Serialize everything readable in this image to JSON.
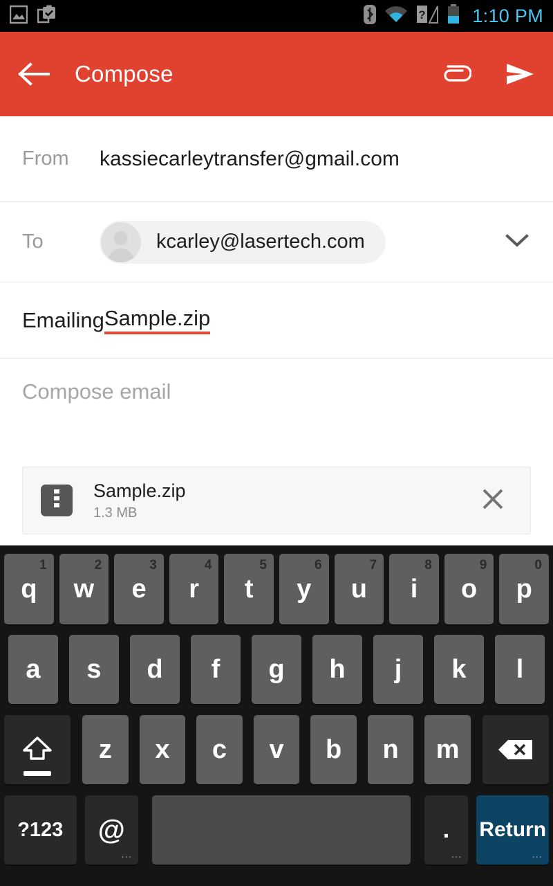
{
  "status_bar": {
    "left_icons": [
      {
        "name": "image-icon",
        "glyph": "image"
      },
      {
        "name": "clipboard-check-icon",
        "glyph": "clipboard"
      }
    ],
    "right_icons": [
      {
        "name": "bluetooth-icon"
      },
      {
        "name": "wifi-icon"
      },
      {
        "name": "cellular-unknown-sim-icon"
      },
      {
        "name": "battery-icon"
      }
    ],
    "time": "1:10 PM",
    "time_color": "#46c8f0",
    "background_color": "#000000"
  },
  "app_bar": {
    "back_label": "Back",
    "title": "Compose",
    "attach_label": "Attach file",
    "send_label": "Send",
    "background_color": "#e0422f",
    "text_color": "#ffffff"
  },
  "compose": {
    "from": {
      "label": "From",
      "value": "kassiecarleytransfer@gmail.com"
    },
    "to": {
      "label": "To",
      "recipient": "kcarley@lasertech.com",
      "expand_label": "Show Cc/Bcc"
    },
    "subject": {
      "prefix": "Emailing ",
      "misspelled": "Sample.zip",
      "full_value": "Emailing Sample.zip",
      "underline_color": "#ef4631"
    },
    "body": {
      "placeholder": "Compose email",
      "value": ""
    },
    "attachment": {
      "icon": "zip-file-icon",
      "name": "Sample.zip",
      "size": "1.3 MB",
      "remove_label": "Remove attachment"
    }
  },
  "keyboard": {
    "background_color": "#151515",
    "key_color": "#5f5f5f",
    "modifier_key_color": "#292929",
    "return_key_color": "#0d4463",
    "row1": [
      {
        "label": "q",
        "sup": "1"
      },
      {
        "label": "w",
        "sup": "2"
      },
      {
        "label": "e",
        "sup": "3"
      },
      {
        "label": "r",
        "sup": "4"
      },
      {
        "label": "t",
        "sup": "5"
      },
      {
        "label": "y",
        "sup": "6"
      },
      {
        "label": "u",
        "sup": "7"
      },
      {
        "label": "i",
        "sup": "8"
      },
      {
        "label": "o",
        "sup": "9"
      },
      {
        "label": "p",
        "sup": "0"
      }
    ],
    "row2": [
      {
        "label": "a"
      },
      {
        "label": "s"
      },
      {
        "label": "d"
      },
      {
        "label": "f"
      },
      {
        "label": "g"
      },
      {
        "label": "h"
      },
      {
        "label": "j"
      },
      {
        "label": "k"
      },
      {
        "label": "l"
      }
    ],
    "row3": {
      "shift": "Shift",
      "letters": [
        {
          "label": "z"
        },
        {
          "label": "x"
        },
        {
          "label": "c"
        },
        {
          "label": "v"
        },
        {
          "label": "b"
        },
        {
          "label": "n"
        },
        {
          "label": "m"
        }
      ],
      "backspace": "Backspace"
    },
    "row4": {
      "symbols": "?123",
      "at": "@",
      "at_hint": "...",
      "space": " ",
      "period": ".",
      "period_hint": "...",
      "return": "Return",
      "return_hint": "..."
    }
  }
}
